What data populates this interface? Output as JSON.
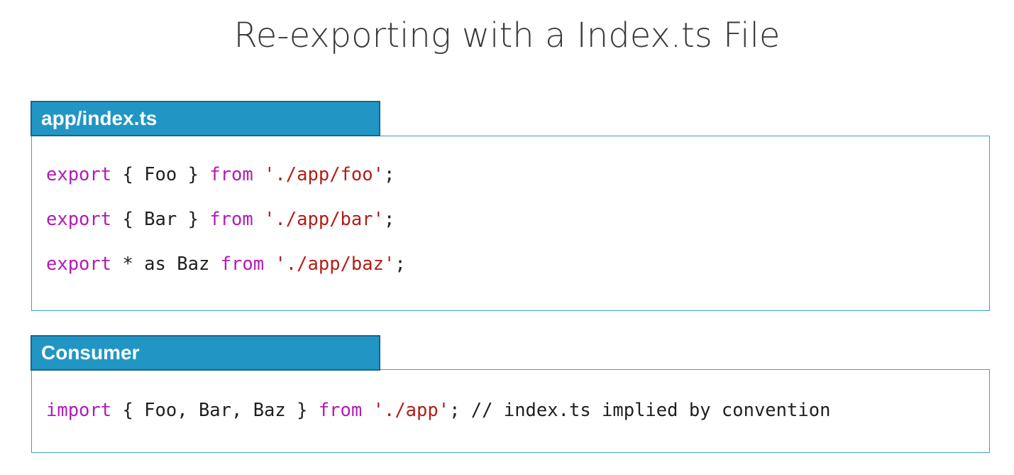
{
  "title": "Re-exporting with a Index.ts File",
  "colors": {
    "tab_background": "#2196c4",
    "tab_border": "#17678a",
    "panel_border": "#3b9fc6",
    "keyword": "#b31ab5",
    "string": "#b21d16",
    "text": "#1f1f1f"
  },
  "panels": [
    {
      "label": "app/index.ts",
      "lines": [
        [
          {
            "t": "kw",
            "v": "export"
          },
          {
            "t": "pun",
            "v": " { Foo } "
          },
          {
            "t": "kw",
            "v": "from"
          },
          {
            "t": "pun",
            "v": " "
          },
          {
            "t": "str",
            "v": "'./app/foo'"
          },
          {
            "t": "pun",
            "v": ";"
          }
        ],
        [
          {
            "t": "kw",
            "v": "export"
          },
          {
            "t": "pun",
            "v": " { Bar } "
          },
          {
            "t": "kw",
            "v": "from"
          },
          {
            "t": "pun",
            "v": " "
          },
          {
            "t": "str",
            "v": "'./app/bar'"
          },
          {
            "t": "pun",
            "v": ";"
          }
        ],
        [
          {
            "t": "kw",
            "v": "export"
          },
          {
            "t": "pun",
            "v": " * as Baz "
          },
          {
            "t": "kw",
            "v": "from"
          },
          {
            "t": "pun",
            "v": " "
          },
          {
            "t": "str",
            "v": "'./app/baz'"
          },
          {
            "t": "pun",
            "v": ";"
          }
        ]
      ]
    },
    {
      "label": "Consumer",
      "lines": [
        [
          {
            "t": "kw",
            "v": "import"
          },
          {
            "t": "pun",
            "v": " { Foo, Bar, Baz } "
          },
          {
            "t": "kw",
            "v": "from"
          },
          {
            "t": "pun",
            "v": " "
          },
          {
            "t": "str",
            "v": "'./app'"
          },
          {
            "t": "pun",
            "v": "; "
          },
          {
            "t": "cmt",
            "v": "// index.ts implied by convention"
          }
        ]
      ]
    }
  ]
}
